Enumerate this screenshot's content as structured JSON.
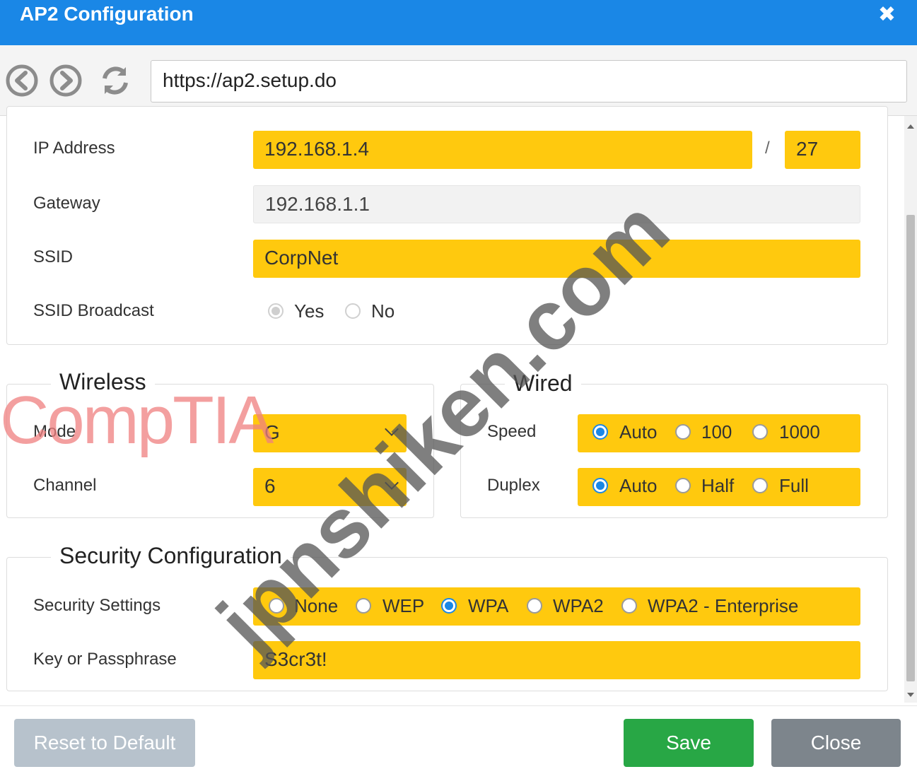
{
  "window": {
    "title": "AP2 Configuration",
    "close_icon": "close-icon"
  },
  "nav": {
    "back_icon": "back-arrow-icon",
    "forward_icon": "forward-arrow-icon",
    "refresh_icon": "refresh-icon",
    "url": "https://ap2.setup.do"
  },
  "network": {
    "ip_label": "IP Address",
    "ip_value": "192.168.1.4",
    "slash": "/",
    "mask_value": "27",
    "gateway_label": "Gateway",
    "gateway_value": "192.168.1.1",
    "ssid_label": "SSID",
    "ssid_value": "CorpNet",
    "broadcast_label": "SSID Broadcast",
    "broadcast_options": [
      "Yes",
      "No"
    ],
    "broadcast_selected": "Yes"
  },
  "wireless": {
    "legend": "Wireless",
    "mode_label": "Mode",
    "mode_value": "G",
    "channel_label": "Channel",
    "channel_value": "6"
  },
  "wired": {
    "legend": "Wired",
    "speed_label": "Speed",
    "speed_options": [
      "Auto",
      "100",
      "1000"
    ],
    "speed_selected": "Auto",
    "duplex_label": "Duplex",
    "duplex_options": [
      "Auto",
      "Half",
      "Full"
    ],
    "duplex_selected": "Auto"
  },
  "security": {
    "legend": "Security Configuration",
    "settings_label": "Security Settings",
    "settings_options": [
      "None",
      "WEP",
      "WPA",
      "WPA2",
      "WPA2 - Enterprise"
    ],
    "settings_selected": "WPA",
    "key_label": "Key or Passphrase",
    "key_value": "S3cr3t!"
  },
  "buttons": {
    "reset": "Reset to Default",
    "save": "Save",
    "close": "Close"
  },
  "watermarks": {
    "logo": "CompTIA",
    "site": "jpnshiken.com"
  },
  "colors": {
    "title_bar": "#1a87e6",
    "highlight": "#ffc90e",
    "save": "#28a745",
    "close": "#7d858c",
    "reset": "#b7c2cc"
  }
}
